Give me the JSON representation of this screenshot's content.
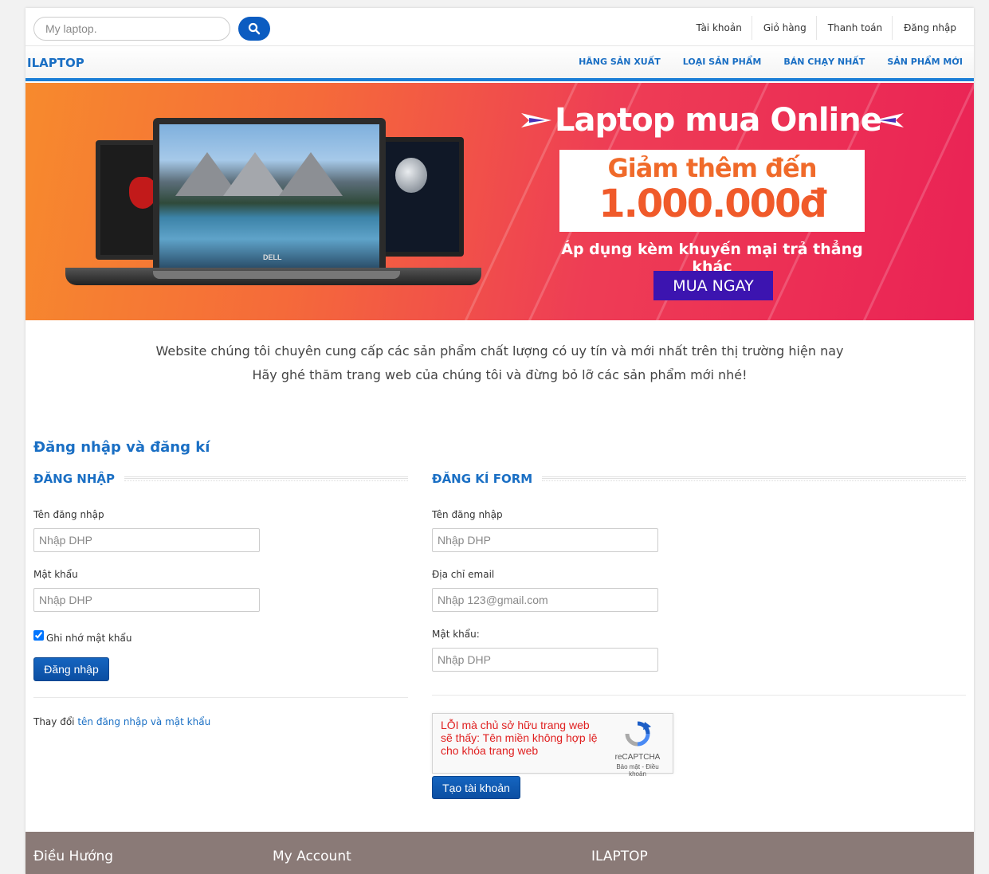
{
  "search": {
    "placeholder": "My laptop."
  },
  "top_links": [
    "Tài khoản",
    "Giỏ hàng",
    "Thanh toán",
    "Đăng nhập"
  ],
  "brand": "ILAPTOP",
  "main_nav": [
    "HÃNG SẢN XUẤT",
    "LOẠI SẢN PHẨM",
    "BÁN CHẠY NHẤT",
    "SẢN PHẨM MỚI"
  ],
  "banner": {
    "title": "Laptop mua Online",
    "line1": "Giảm thêm đến",
    "line2": "1.000.000đ",
    "sub": "Áp dụng kèm khuyến mại trả thẳng khác",
    "button": "MUA NGAY",
    "laptop_brand": "DELL"
  },
  "intro": {
    "line1": "Website chúng tôi chuyên cung cấp các sản phẩm chất lượng có uy tín và mới nhất trên thị trường hiện nay",
    "line2": "Hãy ghé thăm trang web của chúng tôi và đừng bỏ lỡ các sản phẩm mới nhé!"
  },
  "section_title": "Đăng nhập và đăng kí",
  "login": {
    "heading": "ĐĂNG NHẬP",
    "username_label": "Tên đăng nhập",
    "username_placeholder": "Nhập DHP",
    "password_label": "Mật khẩu",
    "password_placeholder": "Nhập DHP",
    "remember_label": "Ghi nhớ mật khẩu",
    "remember_checked": true,
    "submit": "Đăng nhập",
    "change_prefix": "Thay đổi ",
    "change_link": "tên đăng nhập và mật khẩu"
  },
  "register": {
    "heading": "ĐĂNG KÍ FORM",
    "username_label": "Tên đăng nhập",
    "username_placeholder": "Nhập DHP",
    "email_label": "Địa chỉ email",
    "email_placeholder": "Nhập 123@gmail.com",
    "password_label": "Mật khẩu:",
    "password_placeholder": "Nhập DHP",
    "captcha_error": "LỖI mà chủ sở hữu trang web sẽ thấy: Tên miền không hợp lệ cho khóa trang web",
    "captcha_brand": "reCAPTCHA",
    "captcha_terms": "Bảo mật - Điều khoản",
    "submit": "Tạo tài khoản"
  },
  "footer": {
    "col1": "Điều Hướng",
    "col2": "My Account",
    "col3": "ILAPTOP"
  },
  "colors": {
    "accent": "#1a6fc4",
    "button": "#0b5cc1",
    "footer": "#8a7a77"
  }
}
